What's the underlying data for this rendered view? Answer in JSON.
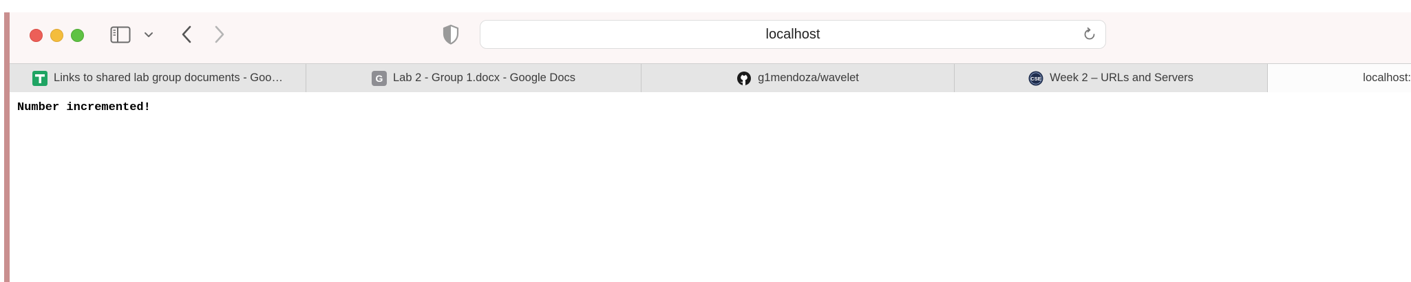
{
  "window": {
    "controls": [
      "close",
      "minimize",
      "zoom"
    ],
    "icons": [
      "sidebar-icon",
      "chevron-down-icon",
      "back-arrow-icon",
      "forward-arrow-icon",
      "shield-icon",
      "reload-icon"
    ]
  },
  "address_bar": {
    "url": "localhost"
  },
  "tabs": [
    {
      "label": "Links to shared lab group documents - Goo…",
      "icon": "google-sheets-icon",
      "active": false
    },
    {
      "label": "Lab 2 - Group 1.docx - Google Docs",
      "icon": "g-letter-icon",
      "active": false
    },
    {
      "label": "g1mendoza/wavelet",
      "icon": "github-icon",
      "active": false
    },
    {
      "label": "Week 2 – URLs and Servers",
      "icon": "cse-badge-icon",
      "active": false
    },
    {
      "label": "localhost:",
      "icon": "",
      "active": true
    }
  ],
  "favicons": {
    "g_letter": "G",
    "cse_badge": "CSE"
  },
  "page": {
    "text": "Number incremented!"
  },
  "colors": {
    "close": "#ec5f58",
    "minimize": "#f4bd3c",
    "zoom": "#5fc244",
    "toolbar_bg": "#fcf6f6",
    "tabbar_bg": "#e5e5e5",
    "accent_border": "#c98f8f"
  }
}
